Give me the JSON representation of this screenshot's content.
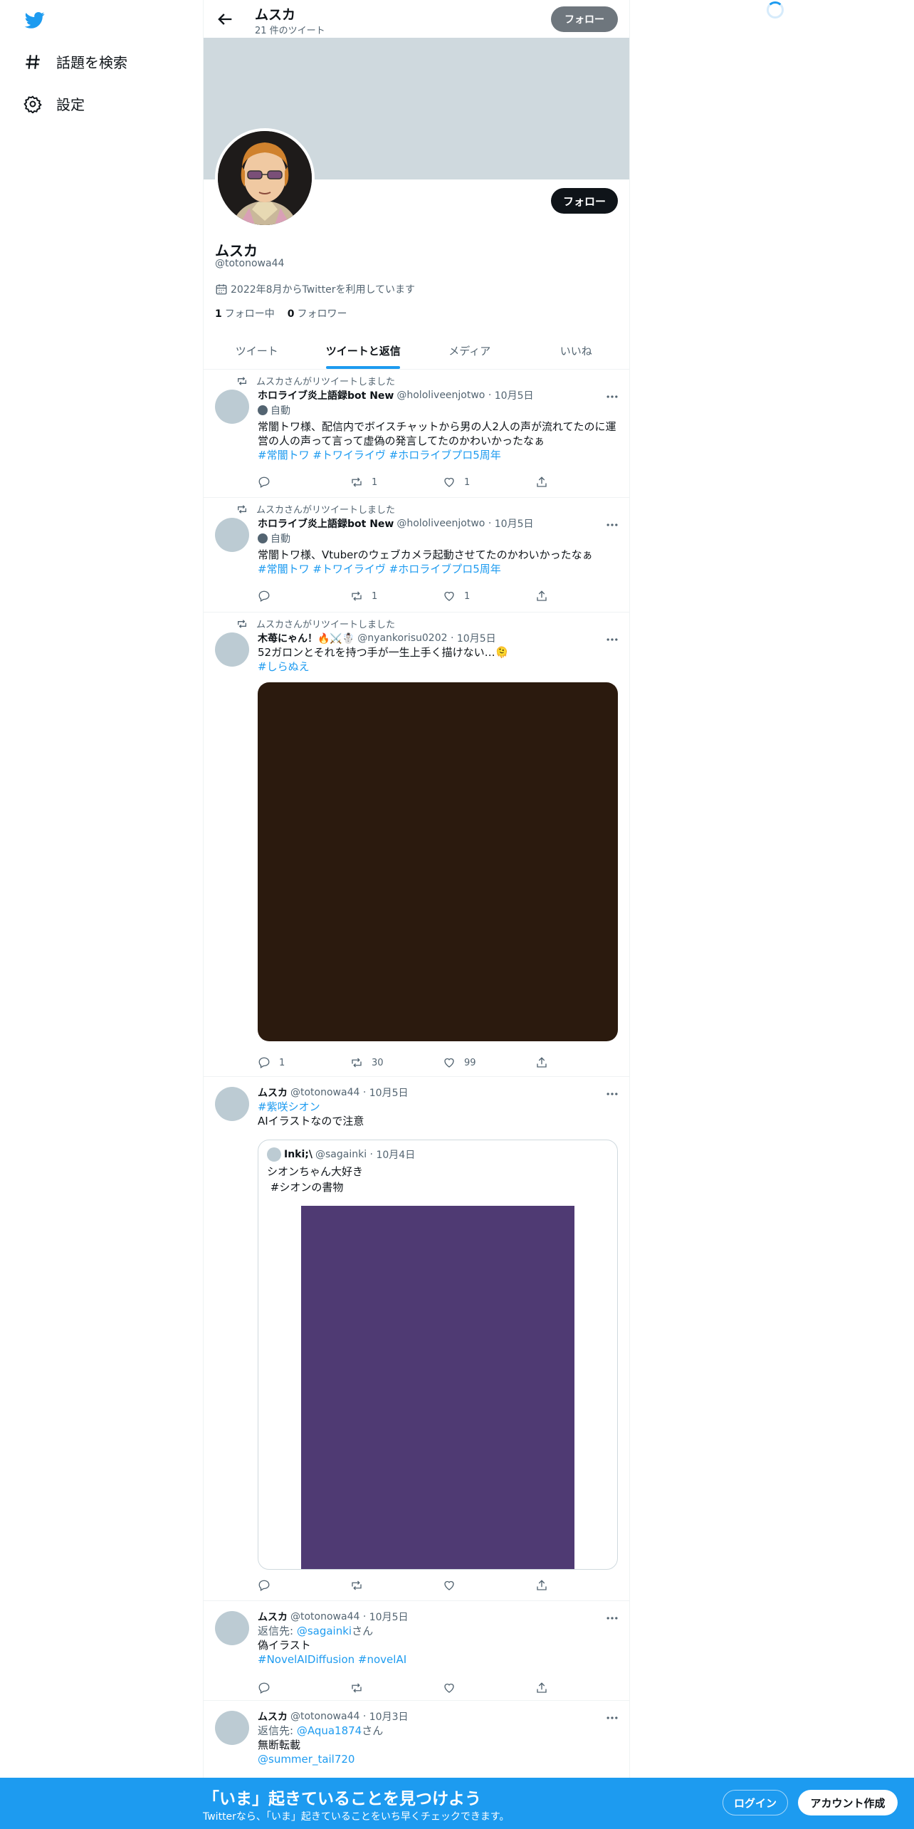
{
  "sidebar": {
    "items": [
      {
        "label": "話題を検索",
        "icon": "hashtag-icon"
      },
      {
        "label": "設定",
        "icon": "gear-icon"
      }
    ]
  },
  "header": {
    "title": "ムスカ",
    "subtitle": "21 件のツイート",
    "follow_label": "フォロー"
  },
  "profile": {
    "name": "ムスカ",
    "handle": "@totonowa44",
    "joined": "2022年8月からTwitterを利用しています",
    "following_count": "1",
    "following_label": "フォロー中",
    "followers_count": "0",
    "followers_label": "フォロワー",
    "follow_label": "フォロー"
  },
  "tabs": [
    {
      "label": "ツイート",
      "active": false
    },
    {
      "label": "ツイートと返信",
      "active": true
    },
    {
      "label": "メディア",
      "active": false
    },
    {
      "label": "いいね",
      "active": false
    }
  ],
  "tweets": [
    {
      "retweeted_by": "ムスカさんがリツイートしました",
      "name": "ホロライブ炎上語録bot New",
      "handle": "@hololiveenjotwo",
      "date": "10月5日",
      "auto_label": "自動",
      "text": "常闇トワ様、配信内でボイスチャットから男の人2人の声が流れてたのに運営の人の声って言って虚偽の発言してたのかわいかったなぁ",
      "tags": "#常闇トワ #トワイライヴ #ホロライブプロ5周年",
      "replies": "",
      "retweets": "1",
      "likes": "1"
    },
    {
      "retweeted_by": "ムスカさんがリツイートしました",
      "name": "ホロライブ炎上語録bot New",
      "handle": "@hololiveenjotwo",
      "date": "10月5日",
      "auto_label": "自動",
      "text": "常闇トワ様、Vtuberのウェブカメラ起動させてたのかわいかったなぁ",
      "tags": "#常闇トワ #トワイライヴ #ホロライブプロ5周年",
      "replies": "",
      "retweets": "1",
      "likes": "1"
    },
    {
      "retweeted_by": "ムスカさんがリツイートしました",
      "name": "木苺にゃん！🔥⚔️☃️",
      "handle": "@nyankorisu0202",
      "date": "10月5日",
      "text": "52ガロンとそれを持つ手が一生上手く描けない…🫠",
      "tags": "#しらぬえ",
      "image_color": "#2b1a0e",
      "replies": "1",
      "retweets": "30",
      "likes": "99"
    },
    {
      "name": "ムスカ",
      "handle": "@totonowa44",
      "date": "10月5日",
      "tags": "#紫咲シオン",
      "text": "AIイラストなので注意",
      "quote": {
        "name": "Inki;\\",
        "handle": "@sagainki",
        "date": "10月4日",
        "text1": "シオンちゃん大好き",
        "text2": " #シオンの書物",
        "image_color": "#4f3a73"
      }
    },
    {
      "name": "ムスカ",
      "handle": "@totonowa44",
      "date": "10月5日",
      "reply_prefix": "返信先: ",
      "reply_to": "@sagainki",
      "reply_suffix": "さん",
      "text": "偽イラスト",
      "tags": "#NovelAIDiffusion #novelAI"
    },
    {
      "name": "ムスカ",
      "handle": "@totonowa44",
      "date": "10月3日",
      "reply_prefix": "返信先: ",
      "reply_to": "@Aqua1874",
      "reply_suffix": "さん",
      "text": "無断転載",
      "tags": "@summer_tail720"
    }
  ],
  "bottom_bar": {
    "title": "「いま」起きていることを見つけよう",
    "subtitle": "Twitterなら、「いま」起きていることをいち早くチェックできます。",
    "login_label": "ログイン",
    "signup_label": "アカウント作成"
  },
  "colors": {
    "accent": "#1d9bf0",
    "bottom_bar": "#1d9bf0"
  }
}
